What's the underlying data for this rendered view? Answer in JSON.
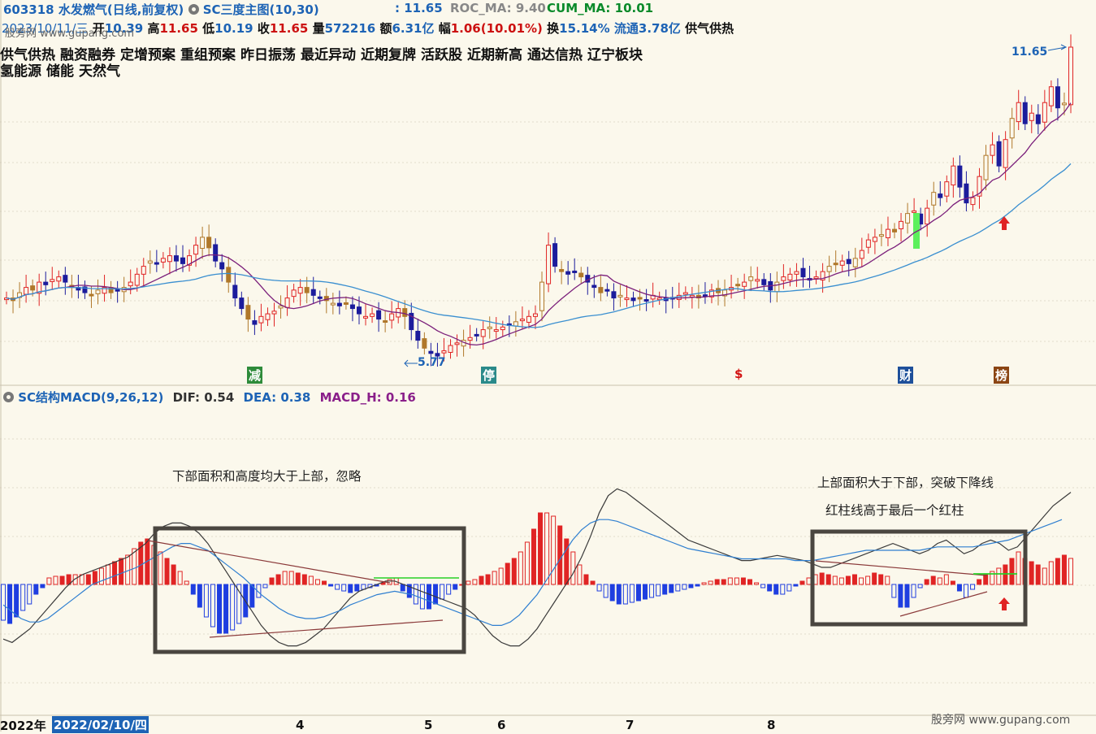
{
  "header": {
    "code": "603318",
    "name": "水发燃气(日线,前复权)",
    "indicator": "SC三度主图(10,30)",
    "price_label": ": 11.65",
    "roc_ma": "ROC_MA: 9.40",
    "cum_ma": "CUM_MA: 10.01"
  },
  "quote": {
    "date": "2023/10/11/三",
    "open_label": "开",
    "open": "10.39",
    "high_label": "高",
    "high": "11.65",
    "low_label": "低",
    "low": "10.19",
    "close_label": "收",
    "close": "11.65",
    "volume_label": "量",
    "volume": "572216",
    "amount_label": "额",
    "amount": "6.31亿",
    "change_label": "幅",
    "change": "1.06(10.01%)",
    "turnover_label": "换",
    "turnover": "15.14%",
    "float_label": "流通",
    "float": "3.78亿",
    "sector": "供气供热"
  },
  "concepts": [
    "供气供热",
    "融资融券",
    "定增预案",
    "重组预案",
    "昨日振荡",
    "最近异动",
    "近期复牌",
    "活跃股",
    "近期新高",
    "通达信热",
    "辽宁板块",
    "氢能源",
    "储能",
    "天然气"
  ],
  "markers": {
    "high_label": "11.65",
    "low_label": "5.77",
    "tags": [
      {
        "text": "减",
        "color": "#2e8b3a"
      },
      {
        "text": "停",
        "color": "#2a8a8a"
      },
      {
        "text": "$",
        "color": "#d21010"
      },
      {
        "text": "财",
        "color": "#1d4f9a"
      },
      {
        "text": "榜",
        "color": "#8b4513"
      }
    ]
  },
  "macd_header": {
    "name": "SC结构MACD(9,26,12)",
    "dif": "DIF: 0.54",
    "dea": "DEA: 0.38",
    "macd_h": "MACD_H: 0.16"
  },
  "annotations": {
    "left": "下部面积和高度均大于上部，忽略",
    "right_1": "上部面积大于下部，突破下降线",
    "right_2": "红柱线高于最后一个红柱"
  },
  "xaxis": {
    "year": "2022年",
    "cursor_date": "2022/02/10/四",
    "months": [
      "4",
      "5",
      "6",
      "7",
      "8"
    ]
  },
  "watermarks": {
    "top": "股旁网 www.gupang.com",
    "bottom": "股旁网 www.gupang.com"
  },
  "colors": {
    "up": "#e02424",
    "down": "#1c1c9c",
    "ma_short": "#7b1f7b",
    "ma_long": "#3a8fd0",
    "dif": "#3a3a3a",
    "dea": "#2f7fd0",
    "macd_pos": "#e02424",
    "macd_neg": "#1f3ee0"
  },
  "chart_data": [
    {
      "type": "candlestick",
      "title": "水发燃气(日线,前复权)",
      "visible_range": [
        5.77,
        11.65
      ],
      "high_marker": 11.65,
      "low_marker": 5.77,
      "last_close": 11.65,
      "closes": [
        6.9,
        6.85,
        7.0,
        7.1,
        7.05,
        7.2,
        7.15,
        7.25,
        7.3,
        7.2,
        7.1,
        7.05,
        7.0,
        6.95,
        7.05,
        7.1,
        7.0,
        7.05,
        7.1,
        7.2,
        7.35,
        7.5,
        7.6,
        7.55,
        7.65,
        7.7,
        7.6,
        7.55,
        7.7,
        7.9,
        8.05,
        7.85,
        7.6,
        7.45,
        7.2,
        6.9,
        6.7,
        6.5,
        6.4,
        6.55,
        6.6,
        6.65,
        6.75,
        6.9,
        7.05,
        7.1,
        7.0,
        6.95,
        6.9,
        6.85,
        6.8,
        6.75,
        6.8,
        6.7,
        6.6,
        6.55,
        6.6,
        6.5,
        6.45,
        6.6,
        6.7,
        6.55,
        6.3,
        6.1,
        5.95,
        5.85,
        5.8,
        5.9,
        6.0,
        6.05,
        6.1,
        6.15,
        6.2,
        6.3,
        6.35,
        6.3,
        6.35,
        6.4,
        6.45,
        6.5,
        6.55,
        6.6,
        7.2,
        7.9,
        7.5,
        7.4,
        7.35,
        7.4,
        7.3,
        7.2,
        7.1,
        7.0,
        7.05,
        6.9,
        6.95,
        6.9,
        6.85,
        6.9,
        6.85,
        6.95,
        6.9,
        6.85,
        6.9,
        6.95,
        7.0,
        6.95,
        6.9,
        6.95,
        7.05,
        7.0,
        7.05,
        7.1,
        7.15,
        7.2,
        7.3,
        7.25,
        7.15,
        7.05,
        7.2,
        7.3,
        7.35,
        7.4,
        7.3,
        7.25,
        7.3,
        7.4,
        7.5,
        7.55,
        7.6,
        7.55,
        7.65,
        7.8,
        8.0,
        8.05,
        8.1,
        8.2,
        8.15,
        8.35,
        8.5,
        8.55,
        8.3,
        8.6,
        8.9,
        8.8,
        9.1,
        9.4,
        9.0,
        8.7,
        8.8,
        9.2,
        9.6,
        9.8,
        9.4,
        9.9,
        10.3,
        10.6,
        10.2,
        10.4,
        10.2,
        10.6,
        10.9,
        10.5,
        10.59,
        11.65
      ],
      "ma_short_label": "ROC_MA",
      "ma_short_last": 9.4,
      "ma_long_label": "CUM_MA",
      "ma_long_last": 10.01
    },
    {
      "type": "bar",
      "title": "SC结构MACD(9,26,12)",
      "series": [
        {
          "name": "MACD_H",
          "last": 0.16,
          "values": [
            -0.22,
            -0.24,
            -0.2,
            -0.16,
            -0.12,
            -0.06,
            -0.02,
            0.04,
            0.05,
            0.05,
            0.06,
            0.06,
            0.06,
            0.06,
            0.08,
            0.1,
            0.12,
            0.14,
            0.16,
            0.18,
            0.22,
            0.26,
            0.28,
            0.24,
            0.2,
            0.16,
            0.12,
            0.08,
            0.02,
            -0.06,
            -0.14,
            -0.2,
            -0.26,
            -0.3,
            -0.3,
            -0.28,
            -0.24,
            -0.2,
            -0.14,
            -0.08,
            -0.02,
            0.04,
            0.06,
            0.08,
            0.08,
            0.07,
            0.06,
            0.05,
            0.03,
            0.02,
            -0.01,
            -0.03,
            -0.04,
            -0.05,
            -0.04,
            -0.03,
            -0.02,
            -0.01,
            0.01,
            0.03,
            0.04,
            -0.04,
            -0.08,
            -0.12,
            -0.15,
            -0.15,
            -0.12,
            -0.09,
            -0.06,
            -0.03,
            0.0,
            0.02,
            0.03,
            0.05,
            0.06,
            0.08,
            0.1,
            0.13,
            0.16,
            0.2,
            0.26,
            0.34,
            0.44,
            0.44,
            0.42,
            0.36,
            0.28,
            0.2,
            0.12,
            0.06,
            0.02,
            -0.04,
            -0.08,
            -0.1,
            -0.12,
            -0.12,
            -0.11,
            -0.1,
            -0.09,
            -0.08,
            -0.07,
            -0.06,
            -0.05,
            -0.04,
            -0.03,
            -0.02,
            -0.01,
            0.01,
            0.02,
            0.03,
            0.03,
            0.04,
            0.04,
            0.04,
            0.03,
            0.01,
            -0.02,
            -0.04,
            -0.06,
            -0.06,
            -0.04,
            -0.01,
            0.02,
            0.04,
            0.06,
            0.07,
            0.06,
            0.05,
            0.04,
            0.05,
            0.06,
            0.04,
            0.05,
            0.07,
            0.06,
            0.05,
            -0.08,
            -0.14,
            -0.14,
            -0.08,
            -0.02,
            0.03,
            0.05,
            0.04,
            0.06,
            0.02,
            -0.04,
            -0.08,
            -0.03,
            0.03,
            0.06,
            0.08,
            0.1,
            0.12,
            0.16,
            0.2,
            0.16,
            0.14,
            0.12,
            0.1,
            0.14,
            0.16,
            0.18,
            0.16
          ]
        },
        {
          "name": "DIF",
          "last": 0.54,
          "values": [
            -0.32,
            -0.34,
            -0.3,
            -0.26,
            -0.2,
            -0.14,
            -0.08,
            -0.02,
            0.03,
            0.06,
            0.08,
            0.1,
            0.12,
            0.14,
            0.16,
            0.2,
            0.24,
            0.3,
            0.34,
            0.36,
            0.36,
            0.34,
            0.3,
            0.24,
            0.16,
            0.08,
            0.0,
            -0.08,
            -0.16,
            -0.24,
            -0.3,
            -0.34,
            -0.36,
            -0.36,
            -0.34,
            -0.3,
            -0.26,
            -0.2,
            -0.14,
            -0.08,
            -0.04,
            -0.02,
            0.0,
            0.02,
            0.02,
            0.0,
            -0.02,
            -0.04,
            -0.06,
            -0.08,
            -0.1,
            -0.12,
            -0.14,
            -0.18,
            -0.24,
            -0.3,
            -0.34,
            -0.36,
            -0.36,
            -0.32,
            -0.26,
            -0.18,
            -0.1,
            -0.02,
            0.06,
            0.16,
            0.28,
            0.42,
            0.52,
            0.56,
            0.54,
            0.5,
            0.46,
            0.42,
            0.38,
            0.34,
            0.3,
            0.26,
            0.24,
            0.22,
            0.2,
            0.18,
            0.16,
            0.14,
            0.14,
            0.15,
            0.16,
            0.17,
            0.16,
            0.15,
            0.14,
            0.12,
            0.1,
            0.1,
            0.12,
            0.14,
            0.16,
            0.18,
            0.2,
            0.22,
            0.24,
            0.22,
            0.2,
            0.18,
            0.2,
            0.24,
            0.26,
            0.22,
            0.18,
            0.2,
            0.24,
            0.26,
            0.24,
            0.2,
            0.22,
            0.28,
            0.34,
            0.4,
            0.46,
            0.5,
            0.54
          ]
        },
        {
          "name": "DEA",
          "last": 0.38,
          "values": [
            -0.12,
            -0.16,
            -0.2,
            -0.22,
            -0.22,
            -0.2,
            -0.16,
            -0.12,
            -0.08,
            -0.04,
            0.0,
            0.02,
            0.04,
            0.06,
            0.08,
            0.1,
            0.13,
            0.16,
            0.19,
            0.22,
            0.24,
            0.24,
            0.22,
            0.2,
            0.16,
            0.12,
            0.08,
            0.04,
            -0.01,
            -0.06,
            -0.1,
            -0.14,
            -0.17,
            -0.19,
            -0.2,
            -0.2,
            -0.19,
            -0.17,
            -0.15,
            -0.12,
            -0.1,
            -0.08,
            -0.06,
            -0.05,
            -0.04,
            -0.05,
            -0.06,
            -0.08,
            -0.1,
            -0.12,
            -0.14,
            -0.16,
            -0.18,
            -0.2,
            -0.22,
            -0.24,
            -0.24,
            -0.22,
            -0.18,
            -0.12,
            -0.06,
            0.02,
            0.1,
            0.18,
            0.26,
            0.32,
            0.36,
            0.38,
            0.38,
            0.37,
            0.35,
            0.33,
            0.31,
            0.29,
            0.27,
            0.25,
            0.23,
            0.21,
            0.2,
            0.19,
            0.18,
            0.17,
            0.16,
            0.15,
            0.15,
            0.15,
            0.15,
            0.15,
            0.15,
            0.14,
            0.14,
            0.14,
            0.15,
            0.16,
            0.17,
            0.18,
            0.19,
            0.2,
            0.2,
            0.2,
            0.2,
            0.2,
            0.2,
            0.2,
            0.21,
            0.22,
            0.22,
            0.22,
            0.22,
            0.22,
            0.23,
            0.24,
            0.25,
            0.26,
            0.28,
            0.3,
            0.32,
            0.34,
            0.36,
            0.38
          ]
        }
      ]
    }
  ]
}
